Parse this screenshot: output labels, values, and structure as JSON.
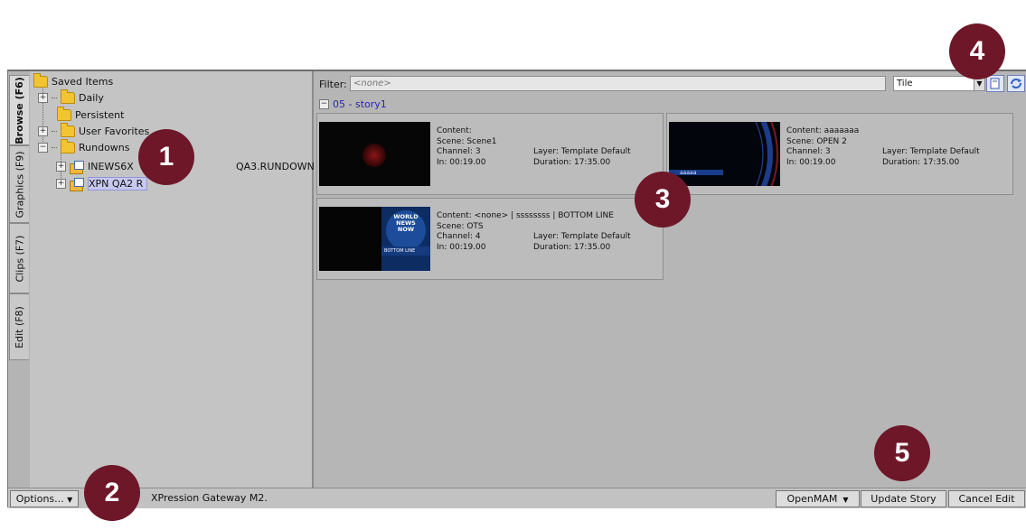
{
  "tabs": [
    {
      "label": "Browse (F6)",
      "active": true
    },
    {
      "label": "Graphics (F9)",
      "active": false
    },
    {
      "label": "Clips (F7)",
      "active": false
    },
    {
      "label": "Edit (F8)",
      "active": false
    }
  ],
  "tree": {
    "root": "Saved Items",
    "daily": "Daily",
    "persistent": "Persistent",
    "user_favorites": "User Favorites",
    "rundowns": "Rundowns",
    "rundown1": "INEWS6X",
    "rundown1_suffix": "QA3.RUNDOWN",
    "rundown2": "XPN QA2 R"
  },
  "filter": {
    "label": "Filter:",
    "placeholder": "<none>"
  },
  "view_mode": {
    "selected": "Tile"
  },
  "group": {
    "label": "05 - story1"
  },
  "cards": [
    {
      "content": "Content:",
      "scene": "Scene: Scene1",
      "channel": "Channel: 3",
      "in": "In: 00:19.00",
      "layer": "Layer: Template Default",
      "duration": "Duration: 17:35.00"
    },
    {
      "content": "Content: aaaaaaa",
      "scene": "Scene: OPEN 2",
      "channel": "Channel: 3",
      "in": "In: 00:19.00",
      "layer": "Layer: Template Default",
      "duration": "Duration: 17:35.00",
      "thumb_text": "aaaaa"
    },
    {
      "content": "Content: <none> | ssssssss | BOTTOM LINE",
      "scene": "Scene: OTS",
      "channel": "Channel: 4",
      "in": "In: 00:19.00",
      "layer": "Layer: Template Default",
      "duration": "Duration: 17:35.00",
      "thumb_title": "WORLD NEWS NOW",
      "thumb_sub": "BOTTOM LINE"
    }
  ],
  "bottom": {
    "options_label": "Options...",
    "status": "XPression Gateway M2.",
    "openmam_label": "OpenMAM",
    "update_label": "Update Story",
    "cancel_label": "Cancel Edit"
  },
  "callouts": [
    "1",
    "2",
    "3",
    "4",
    "5"
  ],
  "colors": {
    "callout": "#6e1728",
    "selection": "#c7c8ef",
    "group_text": "#2727a8"
  }
}
